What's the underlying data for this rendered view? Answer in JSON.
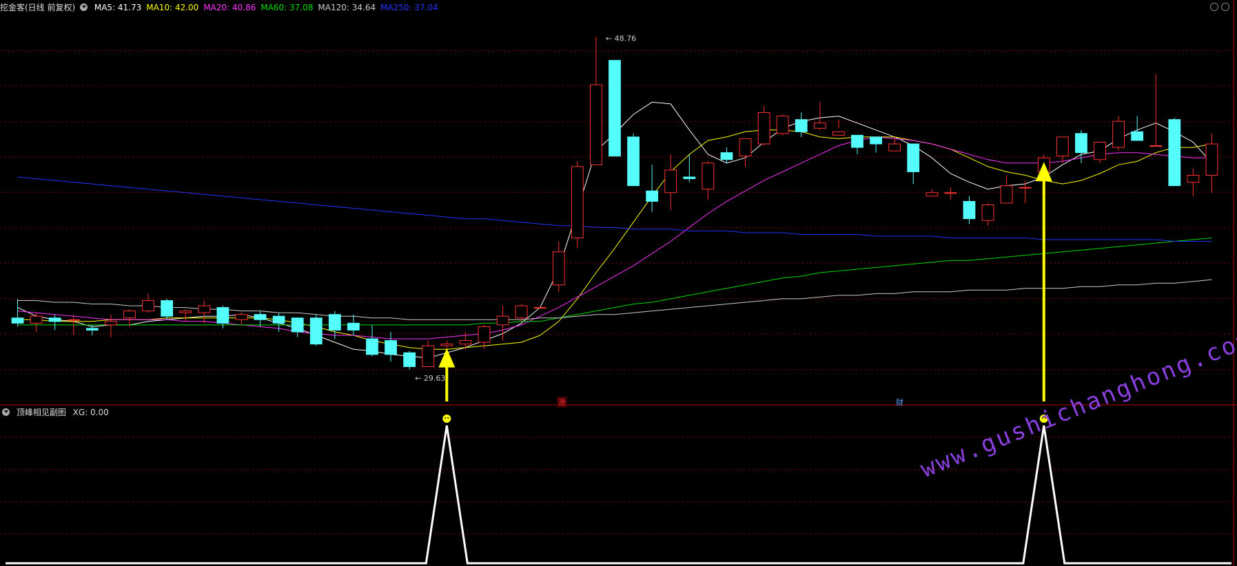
{
  "header": {
    "title": "挖金客(日线 前复权)",
    "ma": [
      {
        "label": "MA5: 41.73",
        "color": "#ffffff"
      },
      {
        "label": "MA10: 42.00",
        "color": "#ffff00"
      },
      {
        "label": "MA20: 40.86",
        "color": "#ff33ff"
      },
      {
        "label": "MA60: 37.08",
        "color": "#00dd00"
      },
      {
        "label": "MA120: 34.64",
        "color": "#cccccc"
      },
      {
        "label": "MA250: 37.04",
        "color": "#2233ff"
      }
    ]
  },
  "sub_header": {
    "title": "顶峰相见副图",
    "value": "XG: 0.00"
  },
  "markers": {
    "zhang": "涨",
    "cai": "财"
  },
  "watermark": "www.gushichanghong.com",
  "colors": {
    "up": "#ff3232",
    "down": "#54fcfc",
    "grid": "#8b0000",
    "signal": "#ffff00"
  },
  "chart_data": {
    "type": "candlestick",
    "price_range": [
      28,
      50
    ],
    "high_label": "48.76",
    "low_label": "29.63",
    "candles": [
      [
        32.6,
        32.3,
        33.7,
        32.1
      ],
      [
        32.3,
        32.7,
        32.9,
        31.8
      ],
      [
        32.6,
        32.4,
        32.8,
        31.9
      ],
      [
        32.5,
        32.5,
        32.8,
        31.6
      ],
      [
        32.0,
        31.9,
        32.2,
        31.6
      ],
      [
        32.2,
        32.4,
        32.8,
        31.5
      ],
      [
        32.6,
        33.0,
        33.1,
        32.1
      ],
      [
        33.0,
        33.6,
        34.0,
        32.9
      ],
      [
        33.6,
        32.7,
        33.7,
        32.5
      ],
      [
        32.9,
        33.0,
        33.1,
        32.4
      ],
      [
        32.9,
        33.3,
        33.6,
        32.3
      ],
      [
        33.2,
        32.3,
        33.3,
        32.0
      ],
      [
        32.5,
        32.8,
        32.9,
        32.2
      ],
      [
        32.8,
        32.5,
        33.0,
        32.1
      ],
      [
        32.7,
        32.3,
        32.9,
        31.8
      ],
      [
        32.6,
        31.8,
        32.6,
        31.5
      ],
      [
        32.6,
        31.1,
        32.8,
        31.0
      ],
      [
        32.8,
        31.9,
        33.0,
        31.4
      ],
      [
        32.3,
        31.9,
        32.8,
        31.6
      ],
      [
        31.4,
        30.5,
        32.2,
        30.4
      ],
      [
        31.3,
        30.5,
        31.8,
        30.1
      ],
      [
        30.6,
        29.8,
        30.7,
        29.63
      ],
      [
        29.8,
        31.0,
        31.3,
        29.8
      ],
      [
        31.0,
        31.1,
        31.3,
        30.5
      ],
      [
        31.1,
        31.3,
        31.8,
        30.8
      ],
      [
        31.2,
        32.1,
        32.2,
        30.8
      ],
      [
        32.2,
        32.7,
        33.3,
        31.3
      ],
      [
        32.6,
        33.3,
        33.4,
        32.4
      ],
      [
        33.2,
        33.2,
        33.2,
        33.2
      ],
      [
        34.5,
        36.4,
        37.0,
        34.1
      ],
      [
        37.2,
        41.3,
        41.6,
        36.6
      ],
      [
        41.4,
        46.0,
        48.76,
        42.0
      ],
      [
        47.4,
        41.9,
        47.4,
        41.9
      ],
      [
        43.0,
        40.2,
        43.2,
        40.2
      ],
      [
        39.9,
        39.3,
        41.4,
        38.7
      ],
      [
        39.8,
        41.1,
        42.0,
        38.8
      ],
      [
        40.7,
        40.6,
        42.0,
        40.4
      ],
      [
        40.0,
        41.5,
        41.6,
        39.4
      ],
      [
        42.1,
        41.7,
        42.4,
        41.5
      ],
      [
        41.9,
        42.9,
        42.8,
        41.3
      ],
      [
        42.6,
        44.4,
        44.8,
        42.5
      ],
      [
        43.2,
        44.2,
        44.3,
        43.1
      ],
      [
        44.0,
        43.3,
        44.4,
        43.0
      ],
      [
        43.5,
        43.8,
        45.0,
        43.4
      ],
      [
        43.1,
        43.3,
        44.0,
        43.5
      ],
      [
        43.1,
        42.4,
        43.0,
        42.0
      ],
      [
        43.0,
        42.6,
        43.0,
        42.1
      ],
      [
        42.2,
        42.6,
        43.0,
        42.4
      ],
      [
        42.6,
        41.0,
        42.6,
        40.3
      ],
      [
        39.6,
        39.8,
        40.0,
        39.6
      ],
      [
        39.8,
        39.8,
        40.1,
        39.4
      ],
      [
        39.3,
        38.3,
        39.6,
        38.0
      ],
      [
        38.2,
        39.1,
        39.2,
        37.9
      ],
      [
        39.2,
        40.2,
        40.8,
        39.5
      ],
      [
        40.1,
        40.1,
        40.5,
        39.2
      ],
      [
        41.0,
        41.8,
        42.0,
        40.6
      ],
      [
        41.9,
        43.0,
        42.0,
        41.5
      ],
      [
        43.2,
        42.1,
        43.4,
        41.5
      ],
      [
        41.7,
        42.7,
        42.6,
        41.5
      ],
      [
        42.4,
        43.9,
        44.2,
        42.2
      ],
      [
        43.3,
        42.8,
        44.2,
        42.8
      ],
      [
        42.5,
        42.5,
        46.6,
        42.5
      ],
      [
        44.0,
        40.2,
        44.1,
        40.2
      ],
      [
        40.4,
        40.8,
        41.2,
        39.6
      ],
      [
        40.8,
        42.6,
        43.2,
        39.8
      ]
    ],
    "series": [
      {
        "name": "MA5",
        "values": [
          33.2,
          32.7,
          32.5,
          32.4,
          32.1,
          32.2,
          32.2,
          32.4,
          32.5,
          32.6,
          32.7,
          32.7,
          32.8,
          32.6,
          32.3,
          32.0,
          31.6,
          31.2,
          30.8,
          30.7,
          30.5,
          30.4,
          30.3,
          30.6,
          30.9,
          31.3,
          31.7,
          32.3,
          33.2,
          35.4,
          38.8,
          42.2,
          43.2,
          44.3,
          45.0,
          44.9,
          43.4,
          42.0,
          41.5,
          41.8,
          42.7,
          43.5,
          43.9,
          44.1,
          44.2,
          43.8,
          43.4,
          43.0,
          42.5,
          41.8,
          40.9,
          40.4,
          40.0,
          40.2,
          40.3,
          40.7,
          41.4,
          42.0,
          42.2,
          42.9,
          43.4,
          43.8,
          43.3,
          42.7,
          41.5
        ]
      },
      {
        "name": "MA10",
        "values": [
          32.5,
          32.5,
          32.4,
          32.4,
          32.4,
          32.5,
          32.5,
          32.5,
          32.6,
          32.6,
          32.6,
          32.6,
          32.6,
          32.6,
          32.5,
          32.3,
          32.1,
          31.8,
          31.6,
          31.3,
          31.1,
          30.9,
          30.8,
          30.8,
          30.9,
          31.0,
          31.1,
          31.2,
          31.6,
          32.4,
          33.7,
          35.2,
          36.6,
          38.1,
          39.6,
          41.0,
          42.0,
          42.8,
          43.0,
          43.3,
          43.4,
          43.4,
          43.3,
          43.0,
          42.9,
          43.0,
          43.0,
          43.0,
          42.8,
          42.6,
          42.3,
          41.8,
          41.3,
          41.0,
          40.8,
          40.5,
          40.3,
          40.5,
          40.9,
          41.4,
          41.6,
          42.1,
          42.4,
          42.4,
          42.6
        ]
      },
      {
        "name": "MA20",
        "values": [
          33.0,
          32.9,
          32.8,
          32.7,
          32.6,
          32.5,
          32.5,
          32.5,
          32.5,
          32.4,
          32.4,
          32.3,
          32.2,
          32.1,
          32.0,
          31.8,
          31.7,
          31.6,
          31.6,
          31.5,
          31.4,
          31.4,
          31.4,
          31.5,
          31.6,
          31.7,
          31.9,
          32.2,
          32.7,
          33.2,
          33.8,
          34.4,
          35.0,
          35.6,
          36.3,
          37.0,
          37.8,
          38.6,
          39.3,
          39.9,
          40.5,
          41.0,
          41.5,
          42.0,
          42.5,
          42.8,
          43.0,
          42.9,
          42.8,
          42.6,
          42.3,
          42.0,
          41.7,
          41.5,
          41.5,
          41.5,
          41.6,
          41.8,
          42.0,
          42.1,
          42.1,
          42.0,
          41.9,
          41.8,
          41.8
        ]
      },
      {
        "name": "MA60",
        "values": [
          32.2,
          32.2,
          32.2,
          32.2,
          32.2,
          32.2,
          32.2,
          32.2,
          32.2,
          32.2,
          32.2,
          32.2,
          32.2,
          32.2,
          32.2,
          32.2,
          32.2,
          32.2,
          32.2,
          32.2,
          32.2,
          32.2,
          32.2,
          32.2,
          32.2,
          32.3,
          32.3,
          32.4,
          32.4,
          32.6,
          32.8,
          33.0,
          33.2,
          33.4,
          33.5,
          33.7,
          33.9,
          34.1,
          34.3,
          34.5,
          34.7,
          34.9,
          35.0,
          35.2,
          35.3,
          35.4,
          35.5,
          35.6,
          35.7,
          35.8,
          35.9,
          35.9,
          36.0,
          36.1,
          36.2,
          36.3,
          36.4,
          36.5,
          36.6,
          36.7,
          36.8,
          36.9,
          37.0,
          37.1,
          37.2
        ]
      },
      {
        "name": "MA120",
        "values": [
          33.6,
          33.6,
          33.5,
          33.5,
          33.4,
          33.4,
          33.3,
          33.3,
          33.2,
          33.2,
          33.1,
          33.1,
          33.0,
          33.0,
          32.9,
          32.9,
          32.8,
          32.7,
          32.7,
          32.6,
          32.6,
          32.5,
          32.5,
          32.5,
          32.5,
          32.5,
          32.5,
          32.5,
          32.6,
          32.6,
          32.7,
          32.8,
          32.8,
          32.9,
          33.0,
          33.1,
          33.2,
          33.3,
          33.4,
          33.5,
          33.6,
          33.7,
          33.7,
          33.8,
          33.9,
          33.9,
          34.0,
          34.0,
          34.1,
          34.1,
          34.1,
          34.2,
          34.2,
          34.2,
          34.3,
          34.3,
          34.3,
          34.4,
          34.4,
          34.5,
          34.5,
          34.6,
          34.6,
          34.7,
          34.8
        ]
      },
      {
        "name": "MA250",
        "values": [
          40.7,
          40.6,
          40.5,
          40.4,
          40.3,
          40.2,
          40.1,
          40.0,
          39.9,
          39.8,
          39.7,
          39.6,
          39.5,
          39.4,
          39.3,
          39.2,
          39.1,
          39.0,
          38.9,
          38.8,
          38.7,
          38.6,
          38.5,
          38.4,
          38.3,
          38.3,
          38.2,
          38.1,
          38.0,
          37.9,
          37.9,
          37.8,
          37.8,
          37.7,
          37.7,
          37.7,
          37.6,
          37.6,
          37.6,
          37.5,
          37.5,
          37.5,
          37.4,
          37.4,
          37.4,
          37.4,
          37.3,
          37.3,
          37.3,
          37.3,
          37.2,
          37.2,
          37.2,
          37.2,
          37.2,
          37.1,
          37.1,
          37.1,
          37.1,
          37.1,
          37.1,
          37.1,
          37.0,
          37.0,
          37.0
        ]
      }
    ],
    "signals": [
      23,
      55
    ],
    "sub_series": {
      "name": "XG",
      "values_at_signals": [
        1,
        1
      ]
    }
  }
}
